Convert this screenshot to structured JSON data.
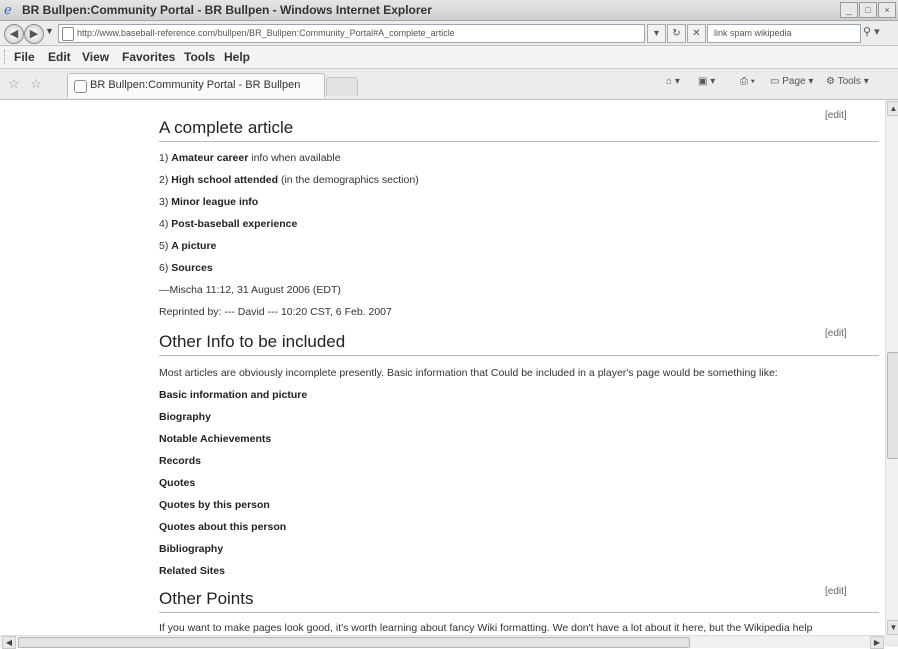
{
  "window": {
    "title": "BR Bullpen:Community Portal - BR Bullpen - Windows Internet Explorer",
    "controls": [
      "_",
      "□",
      "×"
    ]
  },
  "address_bar": {
    "url": "http://www.baseball-reference.com/bullpen/BR_Bullpen:Community_Portal#A_complete_article",
    "search_value": "link spam wikipedia"
  },
  "menu": [
    "File",
    "Edit",
    "View",
    "Favorites",
    "Tools",
    "Help"
  ],
  "tab": {
    "label": "BR Bullpen:Community Portal - BR Bullpen"
  },
  "toolbar": {
    "page_label": "Page",
    "tools_label": "Tools"
  },
  "article": {
    "edit_label": "[edit]",
    "section1": {
      "title": "A complete article",
      "items": [
        {
          "num": "1) ",
          "bold": "Amateur career",
          "rest": " info when available"
        },
        {
          "num": "2) ",
          "bold": "High school attended",
          "rest": " (in the demographics section)"
        },
        {
          "num": "3) ",
          "bold": "Minor league info",
          "rest": ""
        },
        {
          "num": "4) ",
          "bold": "Post-baseball experience",
          "rest": ""
        },
        {
          "num": "5) ",
          "bold": "A picture",
          "rest": ""
        },
        {
          "num": "6) ",
          "bold": "Sources",
          "rest": ""
        }
      ],
      "signature": "—Mischa 11:12, 31 August 2006 (EDT)",
      "reprinted": "Reprinted by: --- David --- 10:20 CST, 6 Feb. 2007"
    },
    "section2": {
      "title": "Other Info to be included",
      "intro": "Most articles are obviously incomplete presently. Basic information that Could be included in a player's page would be something like:",
      "items": [
        "Basic information and picture",
        "Biography",
        "Notable Achievements",
        "Records",
        "Quotes",
        "Quotes by this person",
        "Quotes about this person",
        "Bibliography",
        "Related Sites"
      ]
    },
    "section3": {
      "title": "Other Points",
      "text": "If you want to make pages look good, it's worth learning about fancy Wiki formatting. We don't have a lot about it here, but the Wikipedia help"
    }
  }
}
